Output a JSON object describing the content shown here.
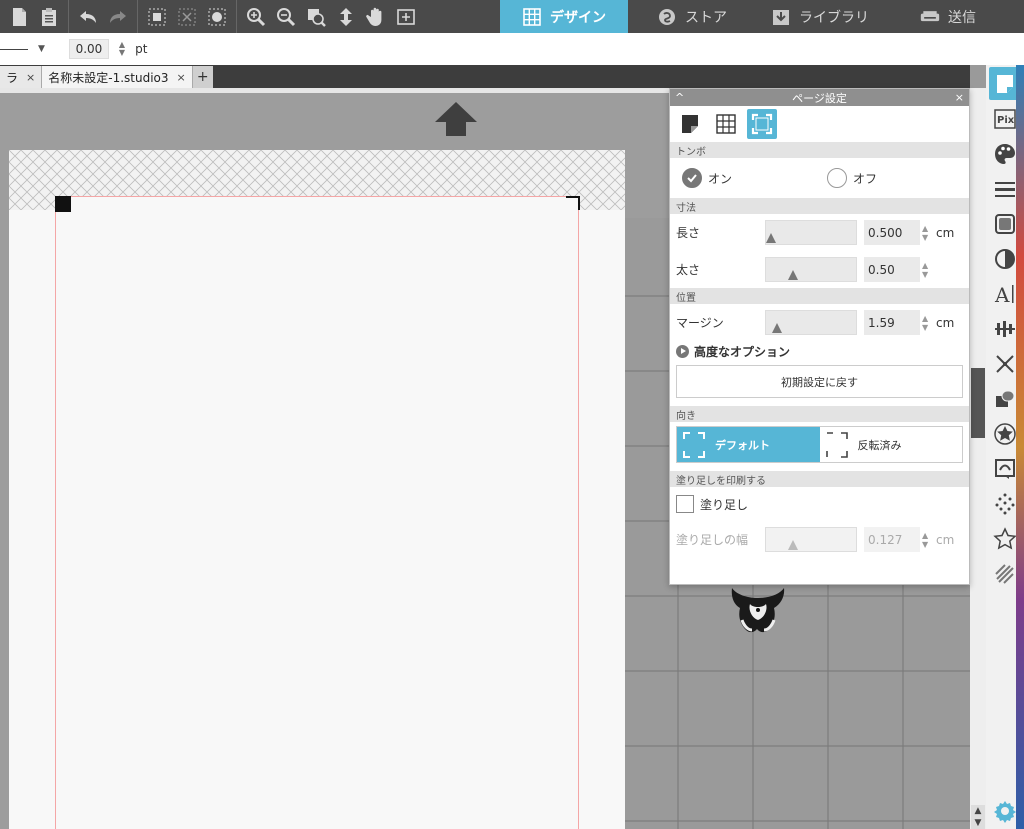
{
  "nav": {
    "tabs": [
      {
        "label": "デザイン",
        "active": true
      },
      {
        "label": "ストア"
      },
      {
        "label": "ライブラリ"
      },
      {
        "label": "送信"
      }
    ]
  },
  "linebar": {
    "value": "0.00",
    "unit": "pt"
  },
  "doctabs": {
    "tab1_label": "ラ",
    "tab2_label": "名称未設定-1.studio3",
    "close": "×",
    "add": "+"
  },
  "panel": {
    "title": "ページ設定",
    "collapse": "^",
    "close": "×",
    "sections": {
      "crop": "トンボ",
      "dims": "寸法",
      "position": "位置",
      "orientation": "向き",
      "bleed": "塗り足しを印刷する"
    },
    "crop_on": "オン",
    "crop_off": "オフ",
    "length": {
      "label": "長さ",
      "value": "0.500",
      "unit": "cm"
    },
    "thickness": {
      "label": "太さ",
      "value": "0.50"
    },
    "margin": {
      "label": "マージン",
      "value": "1.59",
      "unit": "cm"
    },
    "advanced": "高度なオプション",
    "reset": "初期設定に戻す",
    "orient_default": "デフォルト",
    "orient_flipped": "反転済み",
    "bleed_check": "塗り足し",
    "bleed_width": {
      "label": "塗り足しの幅",
      "value": "0.127",
      "unit": "cm"
    }
  },
  "colors": {
    "accent": "#56b6d6",
    "toolbar": "#4a4a4a"
  },
  "icons": [
    "new-page-icon",
    "clipboard-icon",
    "undo-icon",
    "redo-icon",
    "select-all-icon",
    "deselect-icon",
    "fill-icon",
    "zoom-in-icon",
    "zoom-out-icon",
    "zoom-select-icon",
    "fit-icon",
    "pan-icon",
    "add-page-icon"
  ]
}
